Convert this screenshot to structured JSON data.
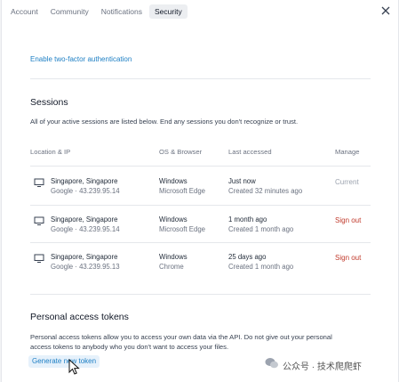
{
  "tabs": [
    {
      "label": "Account"
    },
    {
      "label": "Community"
    },
    {
      "label": "Notifications"
    },
    {
      "label": "Security"
    }
  ],
  "security": {
    "two_factor_link": "Enable two-factor authentication",
    "sessions": {
      "title": "Sessions",
      "description": "All of your active sessions are listed below. End any sessions you don't recognize or trust.",
      "columns": {
        "location": "Location & IP",
        "os": "OS & Browser",
        "last": "Last accessed",
        "manage": "Manage"
      },
      "rows": [
        {
          "location": "Singapore, Singapore",
          "ip": "Google · 43.239.95.14",
          "os": "Windows",
          "browser": "Microsoft Edge",
          "last": "Just now",
          "created": "Created 32 minutes ago",
          "action": "Current"
        },
        {
          "location": "Singapore, Singapore",
          "ip": "Google · 43.239.95.14",
          "os": "Windows",
          "browser": "Microsoft Edge",
          "last": "1 month ago",
          "created": "Created 1 month ago",
          "action": "Sign out"
        },
        {
          "location": "Singapore, Singapore",
          "ip": "Google · 43.239.95.13",
          "os": "Windows",
          "browser": "Chrome",
          "last": "25 days ago",
          "created": "Created 1 month ago",
          "action": "Sign out"
        }
      ]
    },
    "tokens": {
      "title": "Personal access tokens",
      "description_line1": "Personal access tokens allow you to access your own data via the API. Do not give out your personal",
      "description_line2": "access tokens to anybody who you don't want to access your files.",
      "generate_button": "Generate new token"
    }
  },
  "watermark": {
    "text": "公众号 · 技术爬爬虾"
  },
  "colors": {
    "link": "#1d7fc4",
    "danger": "#c0392b",
    "muted": "#9ca3af"
  }
}
